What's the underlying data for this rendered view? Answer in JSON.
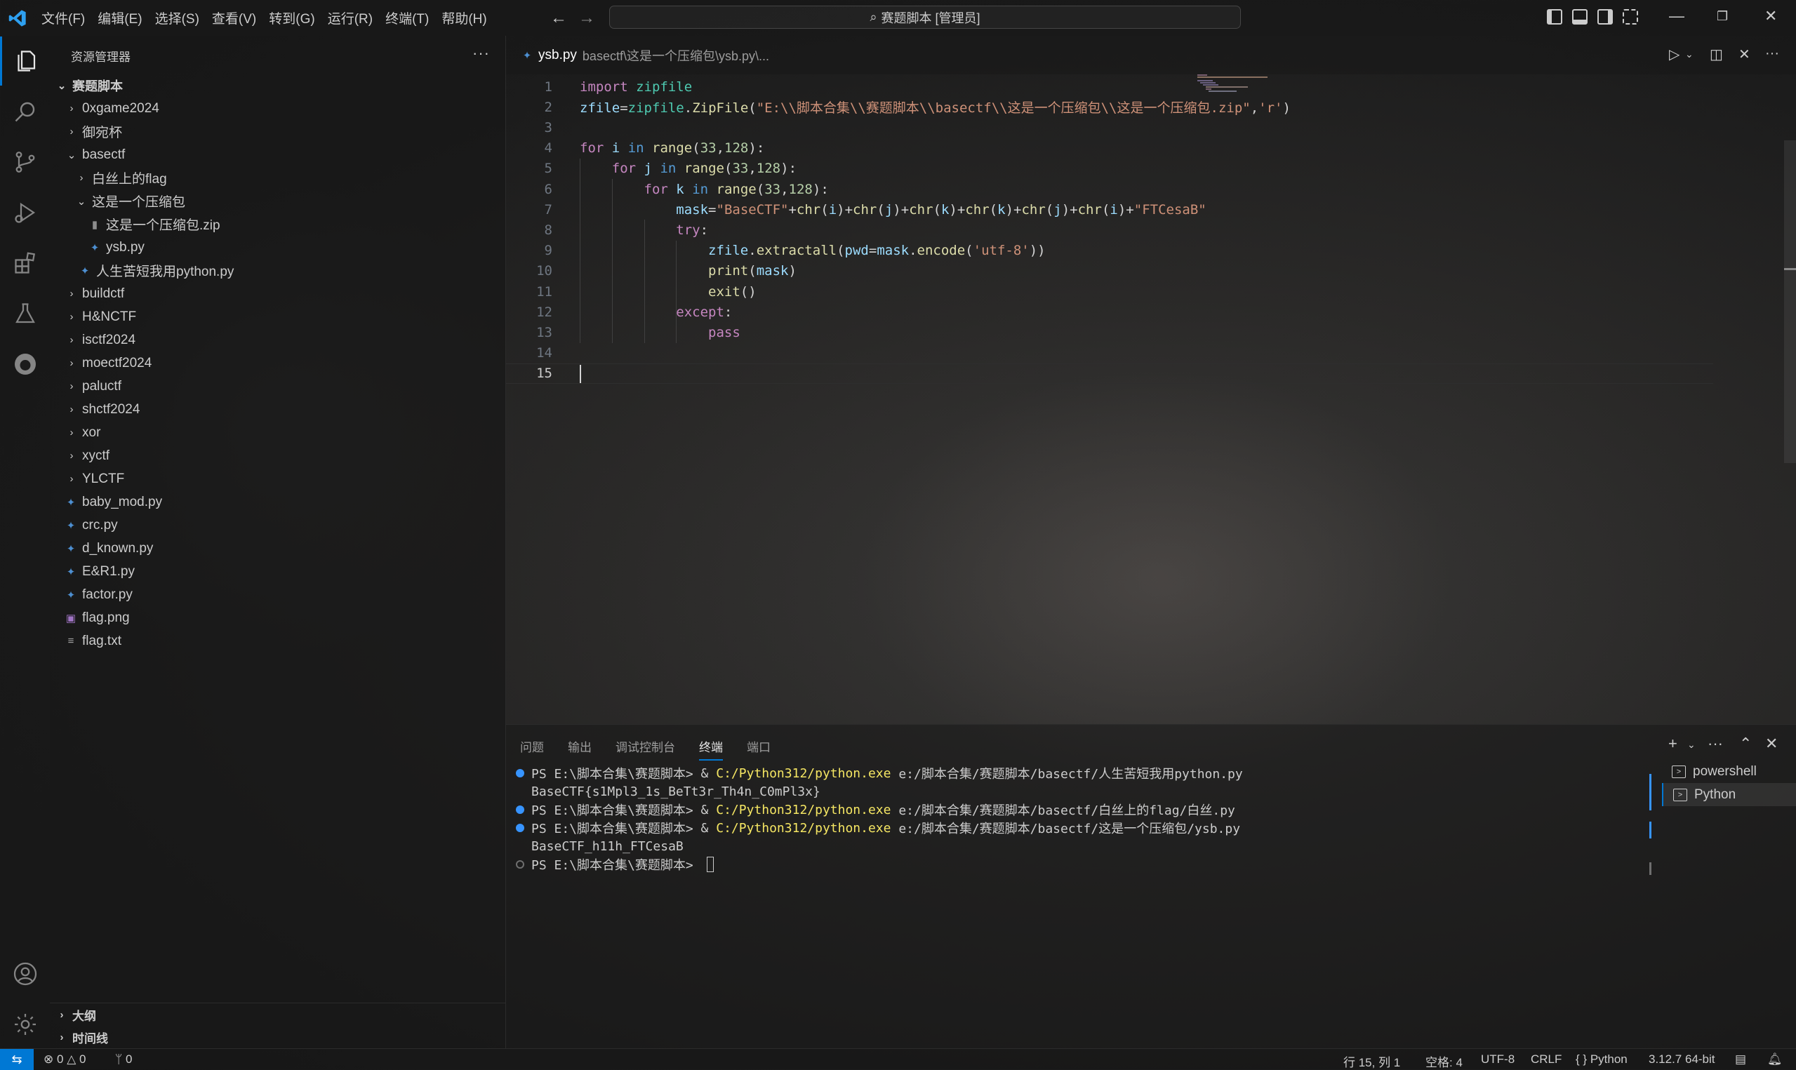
{
  "titlebar": {
    "menu": [
      "文件(F)",
      "编辑(E)",
      "选择(S)",
      "查看(V)",
      "转到(G)",
      "运行(R)",
      "终端(T)",
      "帮助(H)"
    ],
    "search_text": "赛题脚本 [管理员]"
  },
  "sidebar": {
    "title": "资源管理器",
    "root": "赛题脚本",
    "tree": [
      {
        "label": "0xgame2024",
        "depth": 1,
        "type": "folder",
        "expanded": false
      },
      {
        "label": "御宛杯",
        "depth": 1,
        "type": "folder",
        "expanded": false
      },
      {
        "label": "basectf",
        "depth": 1,
        "type": "folder",
        "expanded": true
      },
      {
        "label": "白丝上的flag",
        "depth": 2,
        "type": "folder",
        "expanded": false
      },
      {
        "label": "这是一个压缩包",
        "depth": 2,
        "type": "folder",
        "expanded": true
      },
      {
        "label": "这是一个压缩包.zip",
        "depth": 3,
        "type": "zip"
      },
      {
        "label": "ysb.py",
        "depth": 3,
        "type": "py"
      },
      {
        "label": "人生苦短我用python.py",
        "depth": 2,
        "type": "py"
      },
      {
        "label": "buildctf",
        "depth": 1,
        "type": "folder",
        "expanded": false
      },
      {
        "label": "H&NCTF",
        "depth": 1,
        "type": "folder",
        "expanded": false
      },
      {
        "label": "isctf2024",
        "depth": 1,
        "type": "folder",
        "expanded": false
      },
      {
        "label": "moectf2024",
        "depth": 1,
        "type": "folder",
        "expanded": false
      },
      {
        "label": "paluctf",
        "depth": 1,
        "type": "folder",
        "expanded": false
      },
      {
        "label": "shctf2024",
        "depth": 1,
        "type": "folder",
        "expanded": false
      },
      {
        "label": "xor",
        "depth": 1,
        "type": "folder",
        "expanded": false
      },
      {
        "label": "xyctf",
        "depth": 1,
        "type": "folder",
        "expanded": false
      },
      {
        "label": "YLCTF",
        "depth": 1,
        "type": "folder",
        "expanded": false
      },
      {
        "label": "baby_mod.py",
        "depth": 1,
        "type": "py"
      },
      {
        "label": "crc.py",
        "depth": 1,
        "type": "py"
      },
      {
        "label": "d_known.py",
        "depth": 1,
        "type": "py"
      },
      {
        "label": "E&R1.py",
        "depth": 1,
        "type": "py"
      },
      {
        "label": "factor.py",
        "depth": 1,
        "type": "py"
      },
      {
        "label": "flag.png",
        "depth": 1,
        "type": "img"
      },
      {
        "label": "flag.txt",
        "depth": 1,
        "type": "txt"
      }
    ],
    "outline": "大纲",
    "timeline": "时间线"
  },
  "editor": {
    "tab_name": "ysb.py",
    "tab_path": "basectf\\这是一个压缩包\\ysb.py\\...",
    "line_numbers": [
      "1",
      "2",
      "3",
      "4",
      "5",
      "6",
      "7",
      "8",
      "9",
      "10",
      "11",
      "12",
      "13",
      "14",
      "15"
    ],
    "current_line": "15",
    "code": [
      "import zipfile",
      "zfile=zipfile.ZipFile(\"E:\\\\脚本合集\\\\赛题脚本\\\\basectf\\\\这是一个压缩包\\\\这是一个压缩包.zip\",'r')",
      "",
      "for i in range(33,128):",
      "    for j in range(33,128):",
      "        for k in range(33,128):",
      "            mask=\"BaseCTF\"+chr(i)+chr(j)+chr(k)+chr(k)+chr(j)+chr(i)+\"FTCesaB\"",
      "            try:",
      "                zfile.extractall(pwd=mask.encode('utf-8'))",
      "                print(mask)",
      "                exit()",
      "            except:",
      "                pass",
      "",
      ""
    ]
  },
  "panel": {
    "tabs": [
      "问题",
      "输出",
      "调试控制台",
      "终端",
      "端口"
    ],
    "active_tab": "终端",
    "terminal": [
      {
        "dot": "blue",
        "prompt": "PS E:\\脚本合集\\赛题脚本> ",
        "amp": "& ",
        "exe": "C:/Python312/python.exe",
        "arg": " e:/脚本合集/赛题脚本/basectf/人生苦短我用python.py"
      },
      {
        "dot": "none",
        "text": "BaseCTF{s1Mpl3_1s_BeTt3r_Th4n_C0mPl3x}"
      },
      {
        "dot": "blue",
        "prompt": "PS E:\\脚本合集\\赛题脚本> ",
        "amp": "& ",
        "exe": "C:/Python312/python.exe",
        "arg": " e:/脚本合集/赛题脚本/basectf/白丝上的flag/白丝.py"
      },
      {
        "dot": "blue",
        "prompt": "PS E:\\脚本合集\\赛题脚本> ",
        "amp": "& ",
        "exe": "C:/Python312/python.exe",
        "arg": " e:/脚本合集/赛题脚本/basectf/这是一个压缩包/ysb.py"
      },
      {
        "dot": "none",
        "text": "BaseCTF_h11h_FTCesaB"
      },
      {
        "dot": "hollow",
        "prompt": "PS E:\\脚本合集\\赛题脚本> "
      }
    ],
    "terminals": [
      "powershell",
      "Python"
    ],
    "active_terminal": "Python"
  },
  "statusbar": {
    "errors": "0",
    "warnings": "0",
    "ports": "0",
    "position": "行 15, 列 1",
    "indent": "空格: 4",
    "encoding": "UTF-8",
    "eol": "CRLF",
    "language": "Python",
    "interpreter": "3.12.7 64-bit"
  },
  "colors": {
    "accent": "#0078d4",
    "keyword": "#c586c0",
    "string": "#ce9178",
    "function": "#dcdcaa",
    "variable": "#9cdcfe"
  }
}
